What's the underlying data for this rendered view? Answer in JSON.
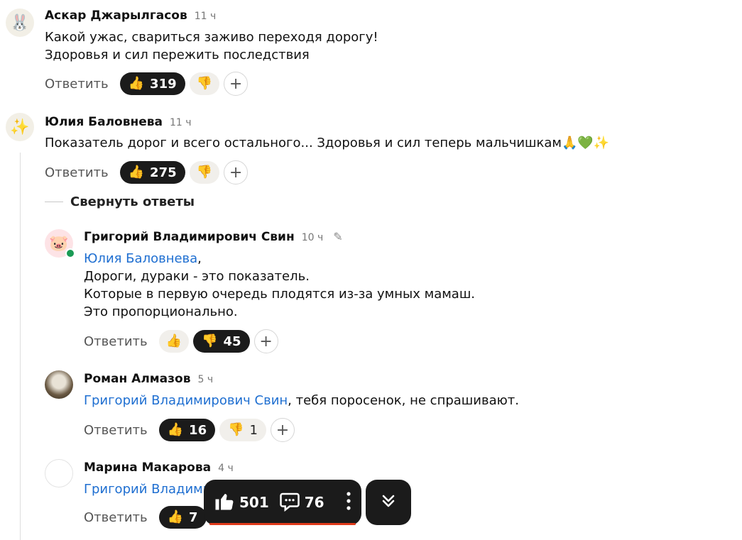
{
  "comments": [
    {
      "author": "Аскар Джарылгасов",
      "time": "11 ч",
      "avatar_icon": "rabbit-icon",
      "avatar_glyph": "🐰",
      "lines": [
        "Какой ужас, свариться заживо переходя дорогу!",
        "Здоровья и сил пережить последствия"
      ],
      "reply": "Ответить",
      "likes": "319",
      "dislikes": ""
    },
    {
      "author": "Юлия Баловнева",
      "time": "11 ч",
      "avatar_icon": "sparkles-icon",
      "avatar_glyph": "✨",
      "lines": [
        "Показатель дорог и всего остального... Здоровья и сил теперь мальчишкам🙏💚✨"
      ],
      "reply": "Ответить",
      "likes": "275",
      "dislikes": ""
    },
    {
      "author": "Григорий Владимирович Свин",
      "time": "10 ч",
      "avatar_icon": "pig-icon",
      "avatar_glyph": "🐷",
      "mention": "Юлия Баловнева",
      "mention_suffix": ",",
      "lines": [
        "Дороги, дураки - это показатель.",
        "Которые в первую очередь плодятся из-за умных мамаш.",
        "Это пропорционально."
      ],
      "reply": "Ответить",
      "likes": "",
      "dislikes": "45"
    },
    {
      "author": "Роман Алмазов",
      "time": "5 ч",
      "mention": "Григорий Владимирович Свин",
      "text_after_mention": ", тебя поросенок, не спрашивают.",
      "reply": "Ответить",
      "likes": "16",
      "dislikes": "1"
    },
    {
      "author": "Марина Макарова",
      "time": "4 ч",
      "mention": "Григорий Владими",
      "reply": "Ответить",
      "likes": "7"
    }
  ],
  "collapse_replies": "Свернуть ответы",
  "float_bar": {
    "likes": "501",
    "comments": "76"
  },
  "colors": {
    "mention": "#1f6fd1",
    "dark_pill": "#1b1b1b",
    "light_pill": "#f1efeb",
    "progress": "#e03a1b"
  }
}
